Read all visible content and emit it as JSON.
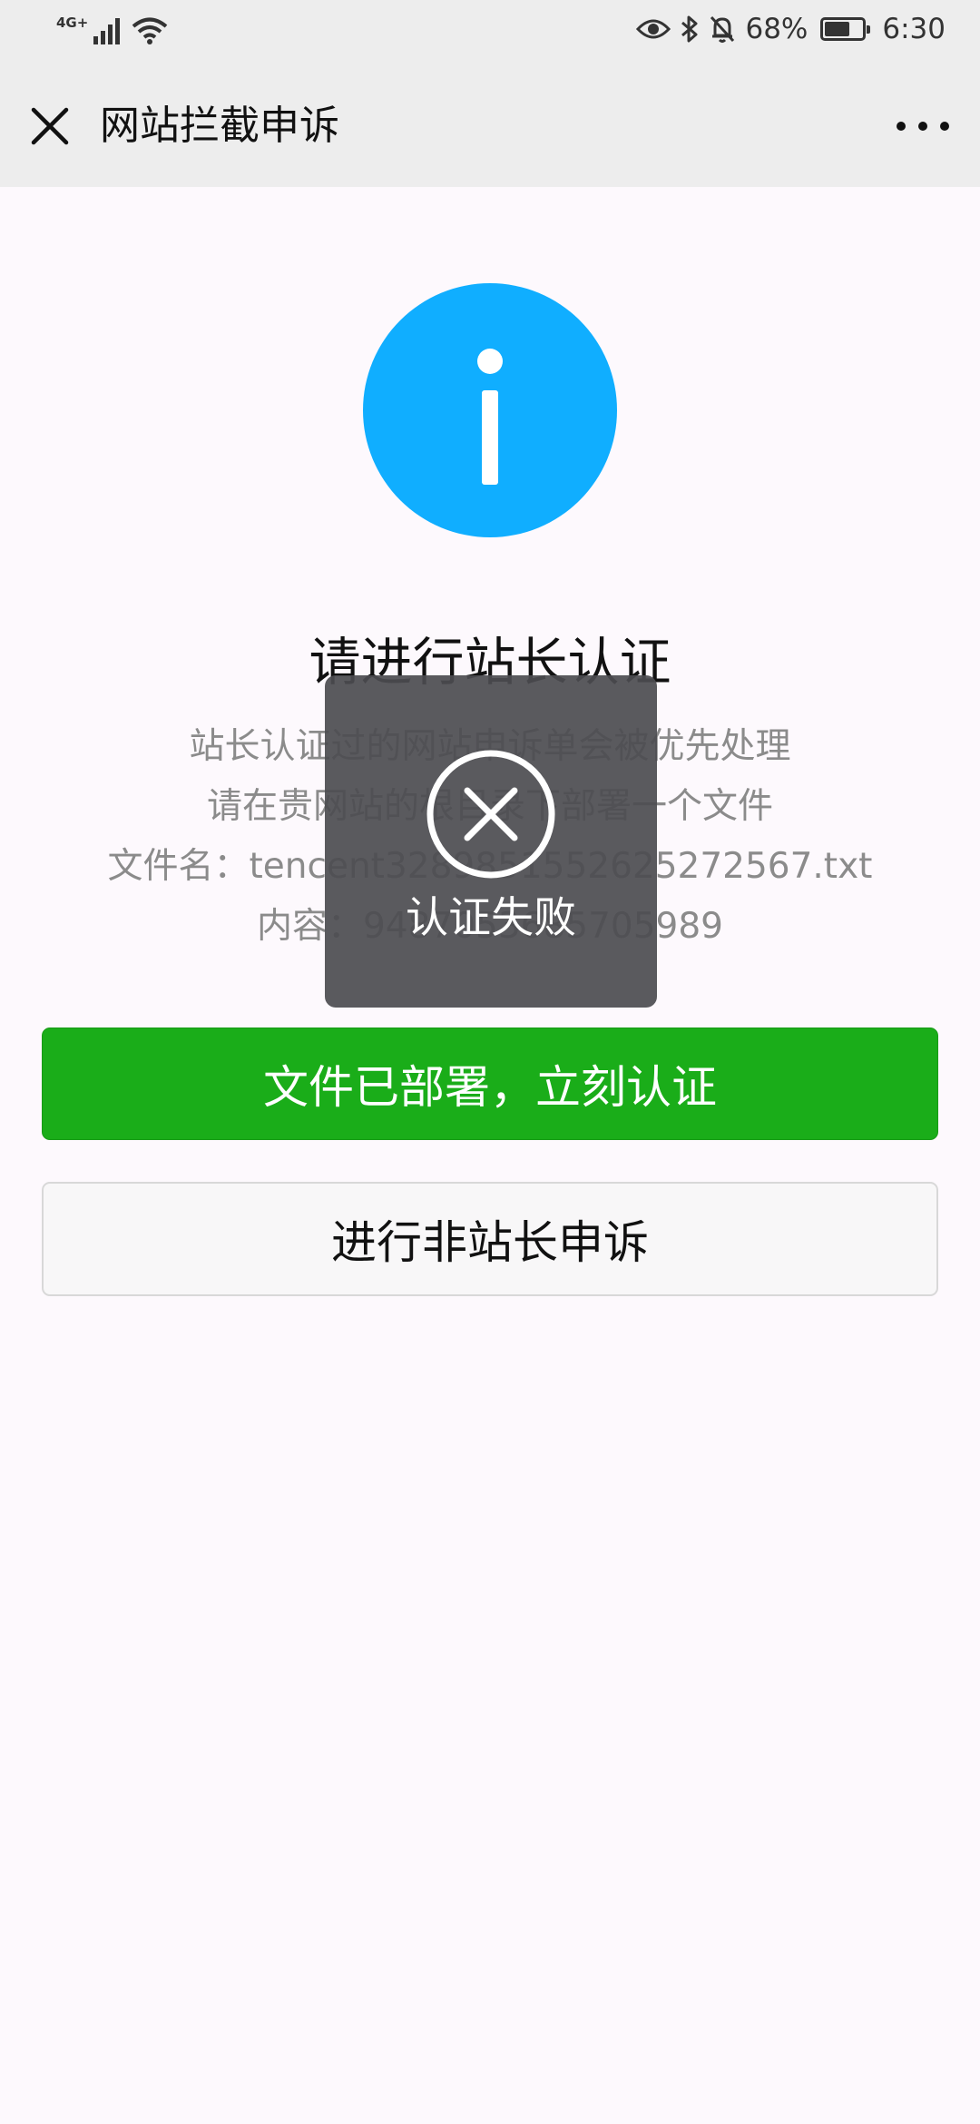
{
  "status_bar": {
    "network": "4G+",
    "battery_percent": "68%",
    "battery_level": 0.68,
    "time": "6:30",
    "icons": [
      "signal-icon",
      "wifi-icon",
      "eye-icon",
      "bluetooth-icon",
      "mute-bell-icon",
      "battery-icon"
    ]
  },
  "nav": {
    "title": "网站拦截申诉",
    "close_icon": "close-icon",
    "more_icon": "more-icon"
  },
  "content": {
    "icon": "info-icon",
    "icon_color": "#10aeff",
    "title": "请进行站长认证",
    "lines": [
      "站长认证过的网站申诉单会被优先处理",
      "请在贵网站的根目录下部署一个文件",
      "文件名：tencent3289851552625272567.txt",
      "内容：9487053685705989"
    ]
  },
  "buttons": {
    "primary": "文件已部署，立刻认证",
    "primary_color": "#1aad19",
    "secondary": "进行非站长申诉"
  },
  "toast": {
    "icon": "fail-x-icon",
    "text": "认证失败"
  }
}
